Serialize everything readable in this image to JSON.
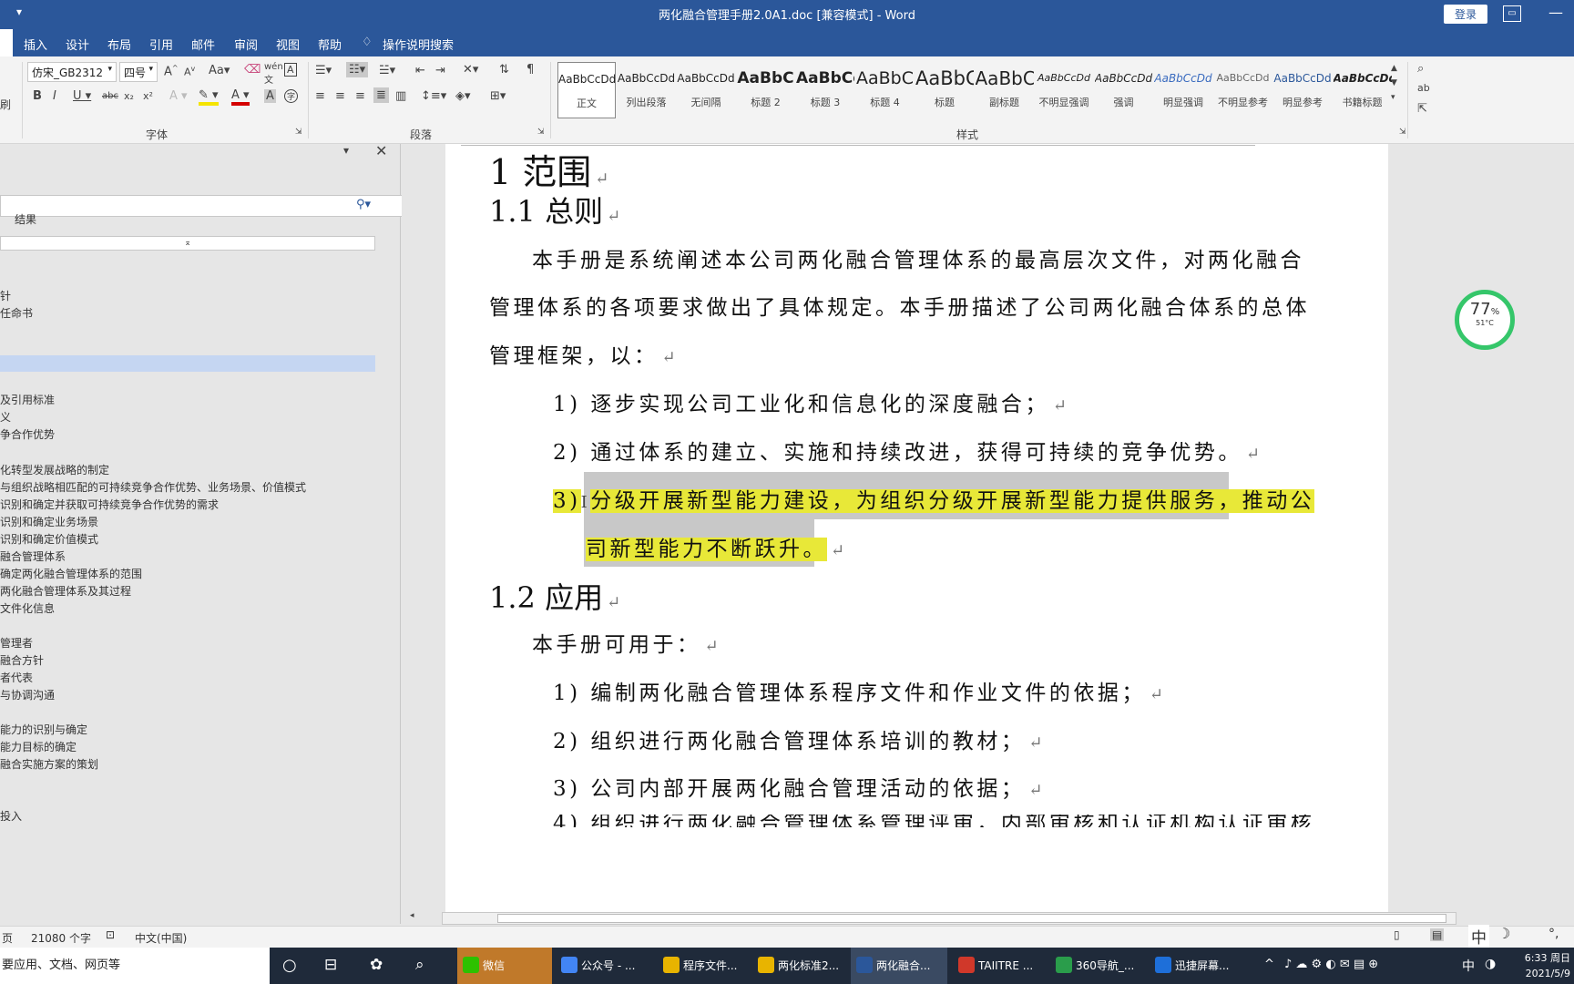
{
  "window": {
    "title": "两化融合管理手册2.0A1.doc [兼容模式]  -  Word",
    "login_label": "登录"
  },
  "tabs": [
    "插入",
    "设计",
    "布局",
    "引用",
    "邮件",
    "审阅",
    "视图",
    "帮助"
  ],
  "tell_me": "操作说明搜索",
  "ribbon": {
    "font_name": "仿宋_GB2312",
    "font_size": "四号",
    "font_group": "字体",
    "paragraph_group": "段落",
    "styles_group": "样式",
    "clipboard_label": "刷",
    "styles": [
      {
        "preview": "AaBbCcDd",
        "name": "正文"
      },
      {
        "preview": "AaBbCcDd",
        "name": "列出段落"
      },
      {
        "preview": "AaBbCcDd",
        "name": "无间隔"
      },
      {
        "preview": "AaBbC",
        "name": "标题 2"
      },
      {
        "preview": "AaBbCc",
        "name": "标题 3"
      },
      {
        "preview": "AaBbC",
        "name": "标题 4"
      },
      {
        "preview": "AaBbC",
        "name": "标题"
      },
      {
        "preview": "AaBbC",
        "name": "副标题"
      },
      {
        "preview": "AaBbCcDd",
        "name": "不明显强调"
      },
      {
        "preview": "AaBbCcDd",
        "name": "强调"
      },
      {
        "preview": "AaBbCcDd",
        "name": "明显强调"
      },
      {
        "preview": "AaBbCcDd",
        "name": "不明显参考"
      },
      {
        "preview": "AaBbCcDd",
        "name": "明显参考"
      },
      {
        "preview": "AaBbCcDd",
        "name": "书籍标题"
      }
    ]
  },
  "nav": {
    "results_tab": "结果",
    "items": [
      "针",
      "任命书",
      "及引用标准",
      "义",
      "争合作优势",
      "化转型发展战略的制定",
      "与组织战略相匹配的可持续竞争合作优势、业务场景、价值模式",
      "识别和确定并获取可持续竞争合作优势的需求",
      "识别和确定业务场景",
      "识别和确定价值模式",
      "融合管理体系",
      "确定两化融合管理体系的范围",
      "两化融合管理体系及其过程",
      "文件化信息",
      "管理者",
      "融合方针",
      "者代表",
      "与协调沟通",
      "能力的识别与确定",
      "能力目标的确定",
      "融合实施方案的策划",
      "投入"
    ]
  },
  "doc": {
    "h1": "1 范围",
    "h2a": "1.1 总则",
    "p1": [
      "本手册是系统阐述本公司两化融合管理体系的最高层次文件，对两化融合",
      "管理体系的各项要求做出了具体规定。本手册描述了公司两化融合体系的总体",
      "管理框架，以："
    ],
    "list1": [
      {
        "num": "1)",
        "text": "逐步实现公司工业化和信息化的深度融合；"
      },
      {
        "num": "2)",
        "text": "通过体系的建立、实施和持续改进，获得可持续的竞争优势。"
      },
      {
        "num": "3)",
        "text": "分级开展新型能力建设，为组织分级开展新型能力提供服务，推动公",
        "cont": "司新型能力不断跃升。"
      }
    ],
    "h2b": "1.2 应用",
    "p2": "本手册可用于：",
    "list2": [
      {
        "num": "1)",
        "text": "编制两化融合管理体系程序文件和作业文件的依据；"
      },
      {
        "num": "2)",
        "text": "组织进行两化融合管理体系培训的教材；"
      },
      {
        "num": "3)",
        "text": "公司内部开展两化融合管理活动的依据；"
      },
      {
        "num": "4)",
        "text": "组织进行两化融合管理体系管理评审，内部审核和认证机构认证审核"
      }
    ],
    "pilcrow": "↵"
  },
  "widget": {
    "percent": "77",
    "pct_sign": "%",
    "temp": "51°C"
  },
  "status": {
    "page": "页",
    "words": "21080 个字",
    "language": "中文(中国)"
  },
  "taskbar": {
    "search": "要应用、文档、网页等",
    "apps": [
      "微信",
      "公众号 - ...",
      "程序文件...",
      "两化标准2...",
      "两化融合...",
      "TAIITRE ...",
      "360导航_...",
      "迅捷屏幕..."
    ],
    "ime": "中",
    "time": "6:33 周日",
    "date": "2021/5/9"
  },
  "colors": {
    "word_blue": "#2b579a",
    "highlight": "#e8e838",
    "widget_ring": "#35c66a"
  }
}
